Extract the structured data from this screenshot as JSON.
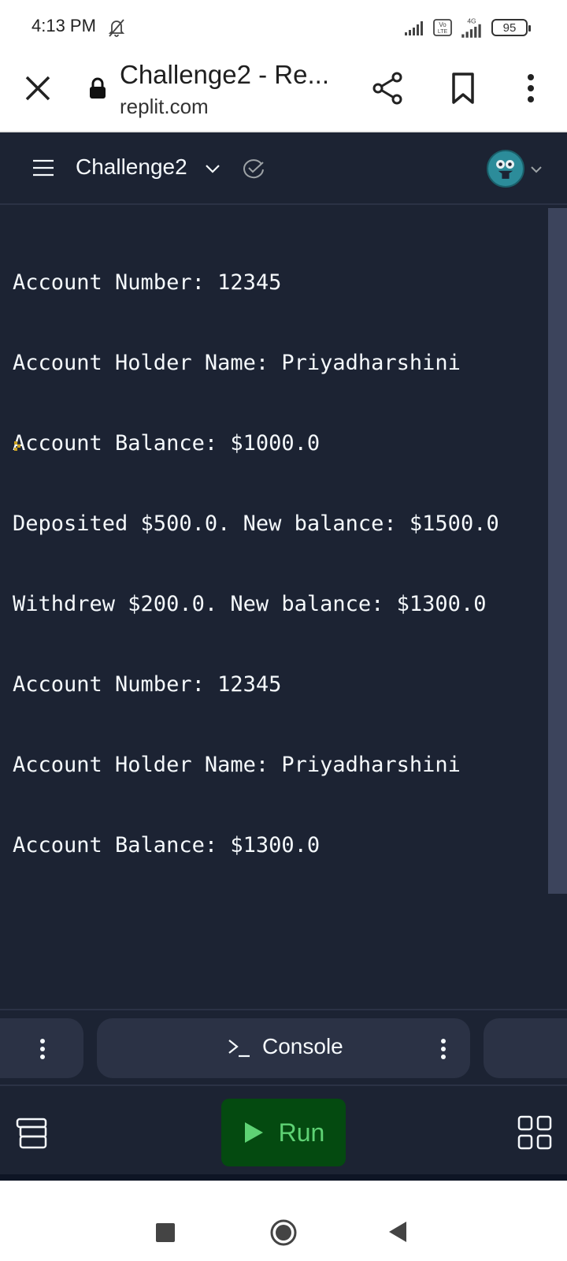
{
  "status_bar": {
    "time": "4:13 PM",
    "battery": "95",
    "network": "4G"
  },
  "browser": {
    "title": "Challenge2 - Re...",
    "url": "replit.com"
  },
  "replit": {
    "repl_name": "Challenge2"
  },
  "console": {
    "lines": [
      "Account Number: 12345",
      "Account Holder Name: Priyadharshini",
      "Account Balance: $1000.0",
      "Deposited $500.0. New balance: $1500.0",
      "Withdrew $200.0. New balance: $1300.0",
      "Account Number: 12345",
      "Account Holder Name: Priyadharshini",
      "Account Balance: $1300.0"
    ]
  },
  "tabs": {
    "console_label": "Console",
    "console_icon_text": ">_"
  },
  "toolbar": {
    "run_label": "Run"
  },
  "colors": {
    "background": "#1c2333",
    "run_button": "#044a10",
    "run_text": "#5ed274",
    "text": "#f5f9fc"
  }
}
